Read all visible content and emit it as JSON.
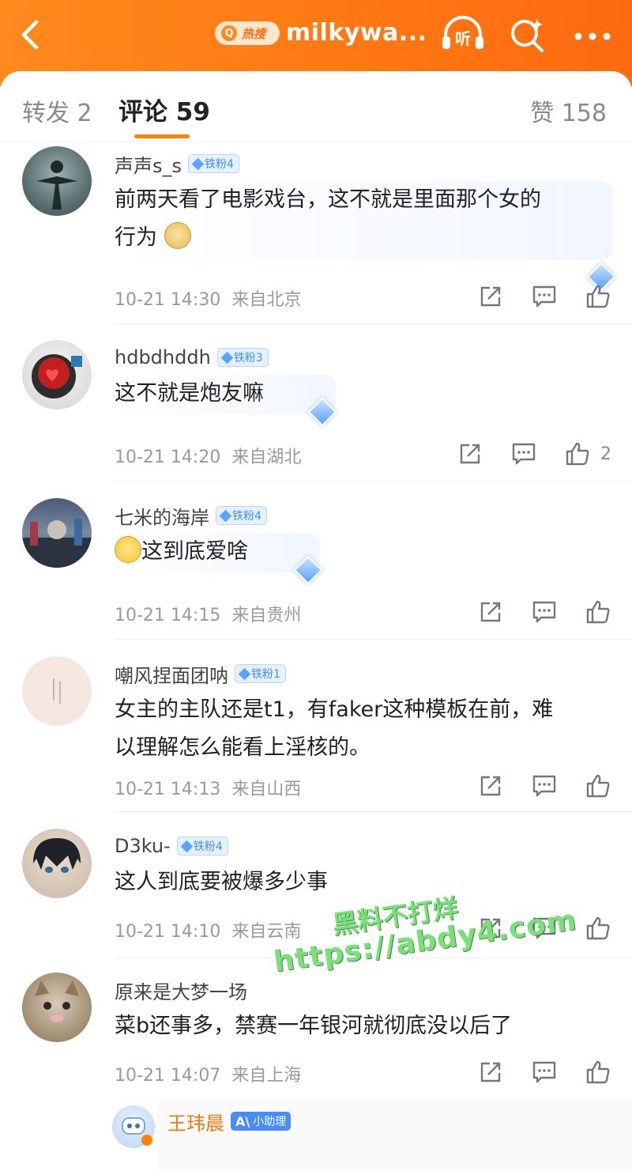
{
  "header": {
    "hot_badge": "热搜",
    "title": "milkywa...",
    "listen_label": "听",
    "colors": {
      "bar": "#ff7a14",
      "accent": "#ff8200"
    }
  },
  "tabs": {
    "repost": "转发 2",
    "comments": "评论 59",
    "likes": "赞 158"
  },
  "comments": [
    {
      "user": "声声s_s",
      "badge": "铁粉4",
      "text1": "前两天看了电影戏台，这不就是里面那个女的",
      "text2": "行为",
      "time": "10-21 14:30",
      "loc": "来自北京"
    },
    {
      "user": "hdbdhddh",
      "badge": "铁粉3",
      "text1": "这不就是炮友嘛",
      "time": "10-21 14:20",
      "loc": "来自湖北",
      "likes": "2"
    },
    {
      "user": "七米的海岸",
      "badge": "铁粉4",
      "text1": "这到底爱啥",
      "time": "10-21 14:15",
      "loc": "来自贵州"
    },
    {
      "user": "嘲风捏面团呐",
      "badge": "铁粉1",
      "text1": "女主的主队还是t1，有faker这种模板在前，难",
      "text2": "以理解怎么能看上淫核的。",
      "time": "10-21 14:13",
      "loc": "来自山西"
    },
    {
      "user": "D3ku-",
      "badge": "铁粉4",
      "text1": "这人到底要被爆多少事",
      "time": "10-21 14:10",
      "loc": "来自云南"
    },
    {
      "user": "原来是大梦一场",
      "text1": "菜b还事多，禁赛一年银河就彻底没以后了",
      "time": "10-21 14:07",
      "loc": "来自上海"
    },
    {
      "user": "王玮晨",
      "badge": "小助理"
    }
  ],
  "watermark": {
    "line1": "黑料不打烊",
    "line2": "https://abdy4.com"
  }
}
